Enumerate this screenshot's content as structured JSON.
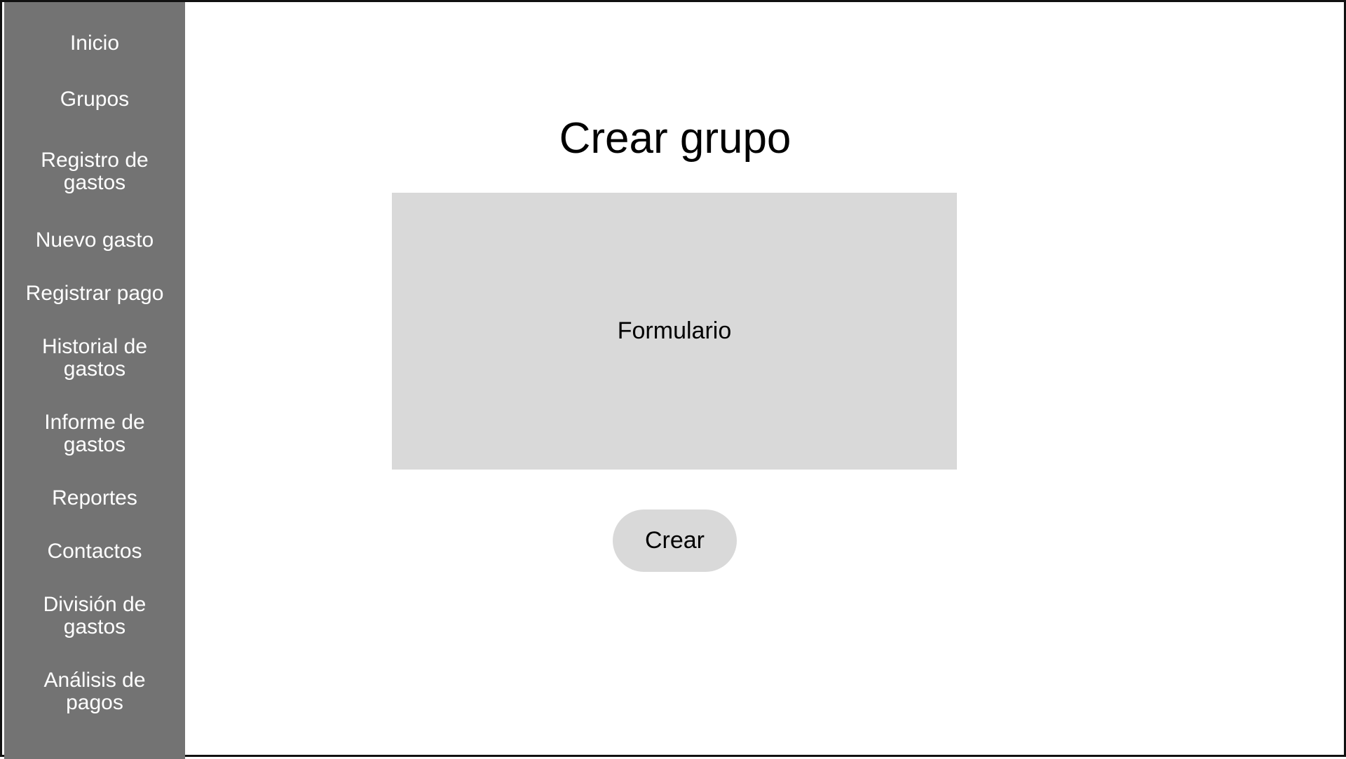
{
  "sidebar": {
    "items": [
      {
        "label": "Inicio"
      },
      {
        "label": "Grupos"
      },
      {
        "label": "Registro de gastos"
      },
      {
        "label": "Nuevo gasto"
      },
      {
        "label": "Registrar pago"
      },
      {
        "label": "Historial de gastos"
      },
      {
        "label": "Informe de gastos"
      },
      {
        "label": "Reportes"
      },
      {
        "label": "Contactos"
      },
      {
        "label": "División de gastos"
      },
      {
        "label": "Análisis de pagos"
      }
    ]
  },
  "main": {
    "title": "Crear grupo",
    "form_placeholder_label": "Formulario",
    "create_button_label": "Crear"
  },
  "colors": {
    "sidebar_bg": "#737373",
    "panel_gray": "#d9d9d9",
    "text_white": "#ffffff",
    "text_black": "#000000"
  }
}
